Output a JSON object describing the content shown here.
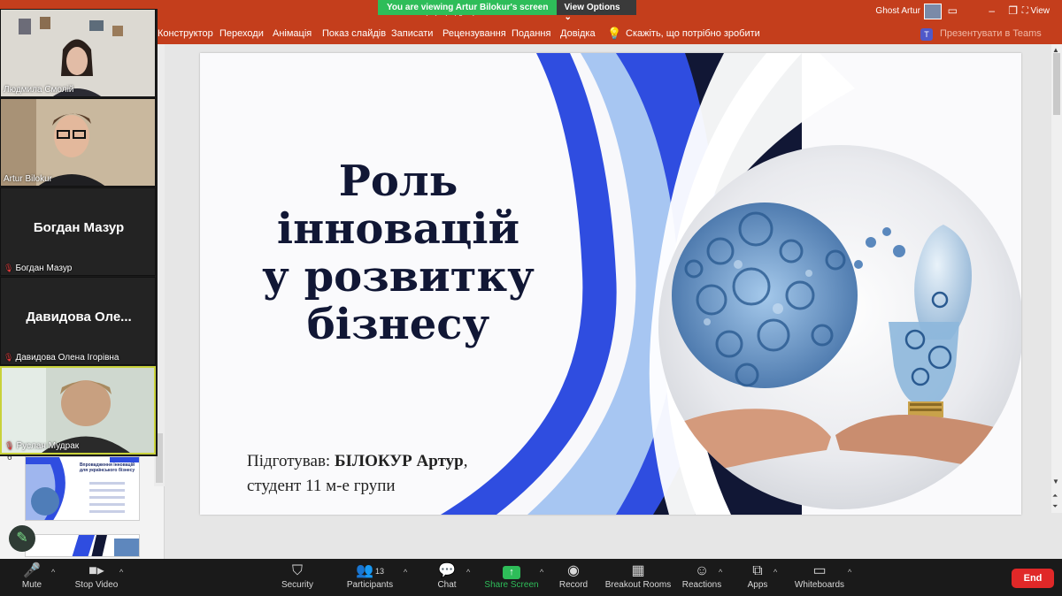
{
  "ppt": {
    "doc_title": "(...) продукт)",
    "user_name": "Ghost Artur",
    "view_label": "View",
    "ribbon_tabs": [
      "Конструктор",
      "Переходи",
      "Анімація",
      "Показ слайдів",
      "Записати",
      "Рецензування",
      "Подання",
      "Довідка",
      "Скажіть, що потрібно зробити"
    ],
    "present_teams": "Презентувати в Teams"
  },
  "share_banner": {
    "viewing": "You are viewing Artur Bilokur's screen",
    "options": "View Options"
  },
  "slide": {
    "title_lines": [
      "Роль",
      "інновацій",
      "у розвитку",
      "бізнесу"
    ],
    "author_prefix": "Підготував: ",
    "author_name": "БІЛОКУР Артур",
    "author_suffix": ",",
    "author_line2": "студент 11 м-е групи"
  },
  "thumbnails": {
    "slide6_number": "6",
    "slide6_title": "Впровадження інновацій для українського бізнесу"
  },
  "participants": [
    {
      "name": "Людмила Смолій",
      "video": true,
      "muted": false
    },
    {
      "name": "Artur Bilokur",
      "video": true,
      "muted": false
    },
    {
      "name": "Богдан Мазур",
      "display": "Богдан Мазур",
      "video": false,
      "muted": true
    },
    {
      "name": "Давидова Олена Ігорівна",
      "display": "Давидова  Оле...",
      "video": false,
      "muted": true
    },
    {
      "name": "Руслан Мудрак",
      "video": true,
      "muted": true
    }
  ],
  "zoombar": {
    "mute": "Mute",
    "stop_video": "Stop Video",
    "security": "Security",
    "participants": "Participants",
    "participants_count": "13",
    "chat": "Chat",
    "share_screen": "Share Screen",
    "record": "Record",
    "breakout_rooms": "Breakout Rooms",
    "reactions": "Reactions",
    "apps": "Apps",
    "whiteboards": "Whiteboards",
    "end": "End"
  },
  "colors": {
    "ppt_red": "#c43e1c",
    "zoom_green": "#2ebd59",
    "slide_navy": "#111735",
    "slide_blue": "#2f4de0",
    "end_red": "#e02828"
  }
}
